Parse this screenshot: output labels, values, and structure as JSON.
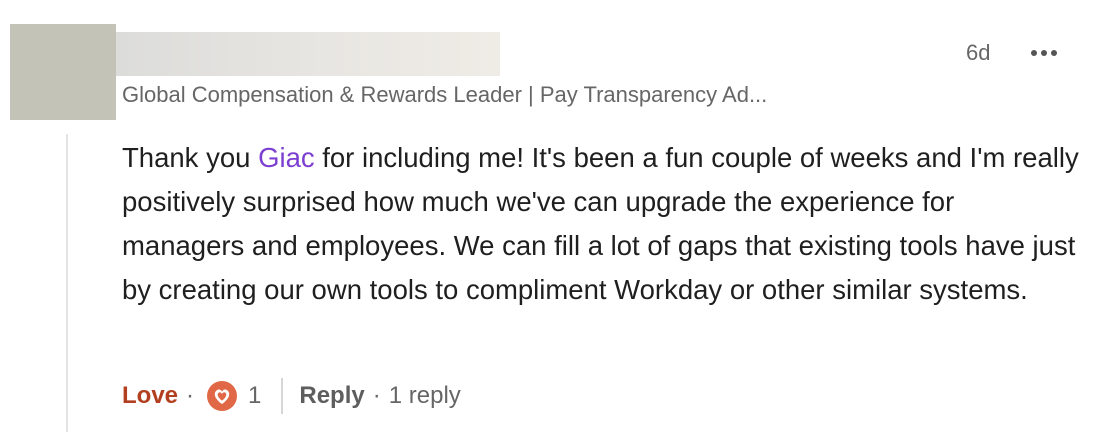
{
  "comment": {
    "timestamp": "6d",
    "headline": "Global Compensation & Rewards Leader | Pay Transparency Ad...",
    "body_before_mention": "Thank you ",
    "mention": "Giac",
    "body_after_mention": " for including me! It's been a fun couple of weeks and I'm really positively surprised how much we've can upgrade the experience for managers and employees. We can fill a lot of gaps that existing tools have just by creating our own tools to compliment Workday or other similar systems."
  },
  "actions": {
    "love_label": "Love",
    "separator": "·",
    "reaction_icon": "love-heart-icon",
    "reaction_count": "1",
    "reply_label": "Reply",
    "reply_count_label": "1 reply"
  },
  "colors": {
    "love": "#b24020",
    "mention": "#7c3fd1",
    "reaction_badge": "#e06847",
    "muted_text": "#666666"
  }
}
